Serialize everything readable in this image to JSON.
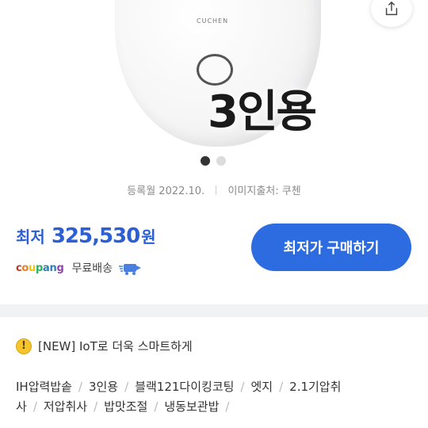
{
  "product": {
    "brand_label": "CUCHEN",
    "capacity_overlay": "3인용"
  },
  "carousel": {
    "count": 2,
    "active_index": 0
  },
  "meta": {
    "registered": "등록월 2022.10.",
    "image_source": "이미지출처: 쿠첸"
  },
  "price": {
    "label": "최저",
    "value": "325,530",
    "unit": "원"
  },
  "seller": {
    "name": "coupang",
    "shipping": "무료배송"
  },
  "buy_button": {
    "label": "최저가 구매하기"
  },
  "notice": {
    "icon": "exclamation-icon",
    "text": "[NEW] IoT로 더욱 스마트하게"
  },
  "specs": {
    "line1": [
      "IH압력밥솥",
      "3인용",
      "블랙121다이킹코팅",
      "엣지",
      "2.1기압취"
    ],
    "line2": [
      "사",
      "저압취사",
      "밥맛조절",
      "냉동보관밥"
    ]
  },
  "colors": {
    "accent": "#2d6be0",
    "price": "#2c5fd3",
    "notice_icon": "#f7c52b"
  }
}
